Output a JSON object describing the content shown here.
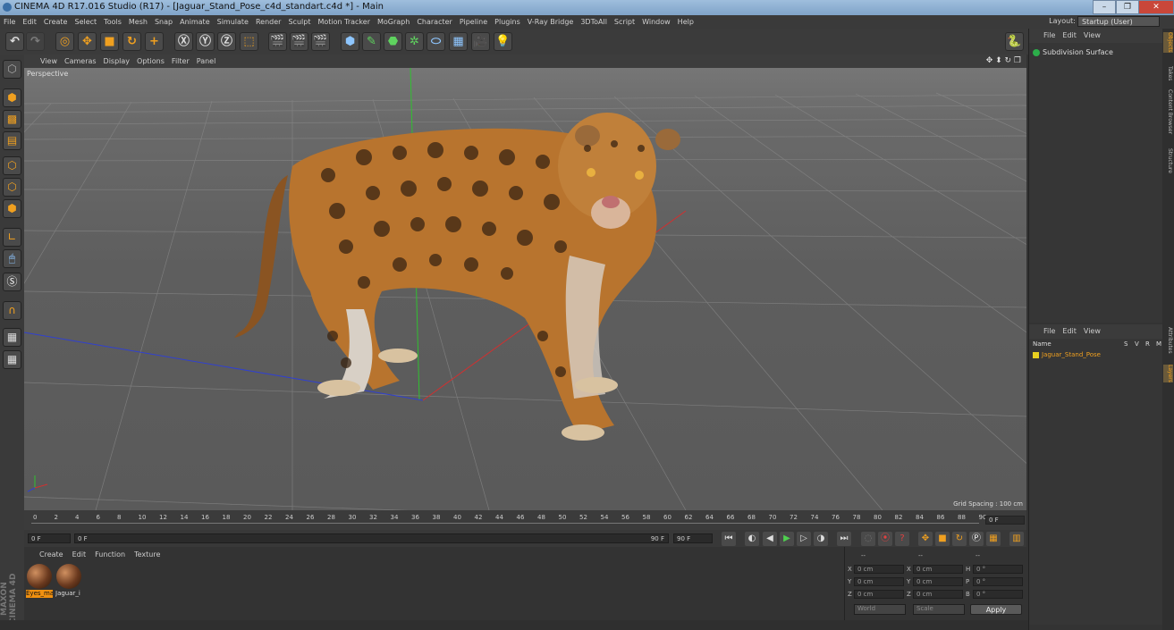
{
  "window": {
    "title": "CINEMA 4D R17.016 Studio (R17) - [Jaguar_Stand_Pose_c4d_standart.c4d *] - Main",
    "min": "–",
    "max": "❐",
    "close": "✕"
  },
  "menubar": {
    "items": [
      "File",
      "Edit",
      "Create",
      "Select",
      "Tools",
      "Mesh",
      "Snap",
      "Animate",
      "Simulate",
      "Render",
      "Sculpt",
      "Motion Tracker",
      "MoGraph",
      "Character",
      "Pipeline",
      "Plugins",
      "V-Ray Bridge",
      "3DToAll",
      "Script",
      "Window",
      "Help"
    ],
    "layout_label": "Layout:",
    "layout_value": "Startup (User)"
  },
  "viewport": {
    "menu": [
      "View",
      "Cameras",
      "Display",
      "Options",
      "Filter",
      "Panel"
    ],
    "camera_label": "Perspective",
    "grid_spacing": "Grid Spacing : 100 cm",
    "colors": {
      "x_axis": "#d03030",
      "y_axis": "#30c030",
      "z_axis": "#3040d0"
    }
  },
  "timeline": {
    "ticks": [
      "0",
      "2",
      "4",
      "6",
      "8",
      "10",
      "12",
      "14",
      "16",
      "18",
      "20",
      "22",
      "24",
      "26",
      "28",
      "30",
      "32",
      "34",
      "36",
      "38",
      "40",
      "42",
      "44",
      "46",
      "48",
      "50",
      "52",
      "54",
      "56",
      "58",
      "60",
      "62",
      "64",
      "66",
      "68",
      "70",
      "72",
      "74",
      "76",
      "78",
      "80",
      "82",
      "84",
      "86",
      "88",
      "90"
    ],
    "current_frame": "0 F"
  },
  "transport": {
    "start": "0 F",
    "range_start": "0 F",
    "range_end": "90 F",
    "end": "90 F"
  },
  "materials": {
    "menu": [
      "Create",
      "Edit",
      "Function",
      "Texture"
    ],
    "items": [
      {
        "name": "Eyes_ma",
        "selected": true
      },
      {
        "name": "Jaguar_i",
        "selected": false
      }
    ]
  },
  "coordinates": {
    "header": [
      "--",
      "--",
      "--"
    ],
    "rows": [
      {
        "a": "X",
        "av": "0 cm",
        "b": "X",
        "bv": "0 cm",
        "c": "H",
        "cv": "0 °"
      },
      {
        "a": "Y",
        "av": "0 cm",
        "b": "Y",
        "bv": "0 cm",
        "c": "P",
        "cv": "0 °"
      },
      {
        "a": "Z",
        "av": "0 cm",
        "b": "Z",
        "bv": "0 cm",
        "c": "B",
        "cv": "0 °"
      }
    ],
    "mode1": "World",
    "mode2": "Scale",
    "apply": "Apply"
  },
  "objects_panel": {
    "menu": [
      "File",
      "Edit",
      "View"
    ],
    "item": "Subdivision Surface"
  },
  "layers_panel": {
    "menu": [
      "File",
      "Edit",
      "View"
    ],
    "col_name": "Name",
    "cols": [
      "S",
      "V",
      "R",
      "M"
    ],
    "item": "Jaguar_Stand_Pose"
  },
  "side_tabs": [
    "Objects",
    "Takes",
    "Content Browser",
    "Structure",
    "Attributes",
    "Layers"
  ],
  "brand": "MAXON CINEMA 4D"
}
